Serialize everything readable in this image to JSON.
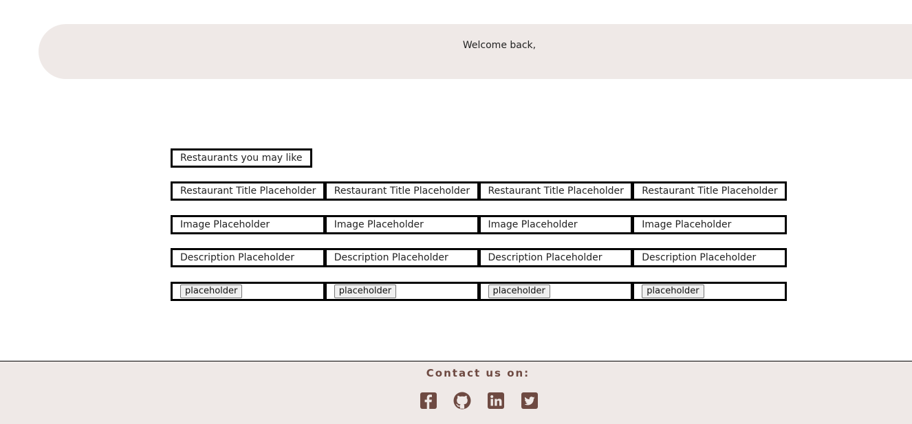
{
  "header": {
    "welcome_text": "Welcome back,"
  },
  "main": {
    "section_title": "Restaurants you may like",
    "restaurants": [
      {
        "title": "Restaurant Title Placeholder",
        "image": "Image Placeholder",
        "description": "Description Placeholder",
        "button_label": "placeholder"
      },
      {
        "title": "Restaurant Title Placeholder",
        "image": "Image Placeholder",
        "description": "Description Placeholder",
        "button_label": "placeholder"
      },
      {
        "title": "Restaurant Title Placeholder",
        "image": "Image Placeholder",
        "description": "Description Placeholder",
        "button_label": "placeholder"
      },
      {
        "title": "Restaurant Title Placeholder",
        "image": "Image Placeholder",
        "description": "Description Placeholder",
        "button_label": "placeholder"
      }
    ]
  },
  "footer": {
    "contact_label": "Contact us on:",
    "social_links": [
      {
        "name": "facebook-icon"
      },
      {
        "name": "github-icon"
      },
      {
        "name": "linkedin-icon"
      },
      {
        "name": "twitter-icon"
      }
    ]
  },
  "colors": {
    "banner_background": "#efe9e7",
    "footer_background": "#efe9e7",
    "accent_brown": "#6e4a42",
    "border": "#000000"
  }
}
